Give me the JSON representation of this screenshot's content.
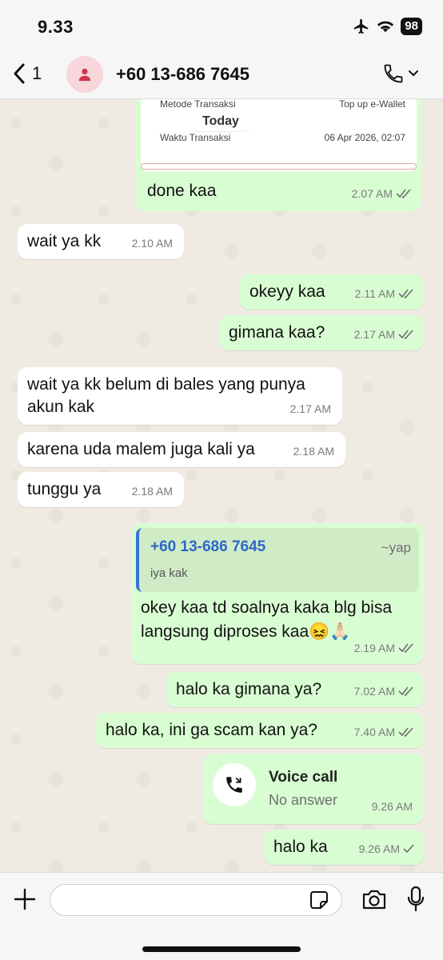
{
  "status_bar": {
    "time": "9.33",
    "battery": "98"
  },
  "header": {
    "back_count": "1",
    "contact_name": "+60 13-686 7645"
  },
  "receipt": {
    "method_label": "Metode Transaksi",
    "method_value": "Top up e-Wallet",
    "time_label": "Waktu Transaksi",
    "time_value": "06 Apr 2026, 02:07"
  },
  "date_chip": "Today",
  "messages": [
    {
      "text": "done kaa",
      "time": "2.07 AM"
    },
    {
      "text": "wait ya kk",
      "time": "2.10 AM"
    },
    {
      "text": "okeyy kaa",
      "time": "2.11 AM"
    },
    {
      "text": "gimana kaa?",
      "time": "2.17 AM"
    },
    {
      "text": "wait ya kk belum di bales yang punya akun kak",
      "time": "2.17 AM"
    },
    {
      "text": "karena uda malem juga kali ya",
      "time": "2.18 AM"
    },
    {
      "text": "tunggu ya",
      "time": "2.18 AM"
    },
    {
      "text": "okey kaa td soalnya kaka blg bisa langsung diproses kaa😖🙏🏻",
      "time": "2.19 AM",
      "quote": {
        "name": "+60 13-686 7645",
        "alias": "~yap",
        "text": "iya kak"
      }
    },
    {
      "text": "halo ka gimana ya?",
      "time": "7.02 AM"
    },
    {
      "text": "halo ka, ini ga scam kan ya?",
      "time": "7.40 AM"
    },
    {
      "call_title": "Voice call",
      "call_status": "No answer",
      "time": "9.26 AM"
    },
    {
      "text": "halo ka",
      "time": "9.26 AM"
    }
  ],
  "composer": {
    "placeholder": ""
  },
  "icons": {
    "back": "chevron-left-icon",
    "avatar": "person-icon",
    "call": "phone-icon",
    "plus": "plus-icon",
    "sticker": "sticker-icon",
    "camera": "camera-icon",
    "mic": "microphone-icon"
  },
  "colors": {
    "outgoing_bubble": "#d9fdd3",
    "incoming_bubble": "#ffffff",
    "quote_accent": "#2f66c9"
  }
}
